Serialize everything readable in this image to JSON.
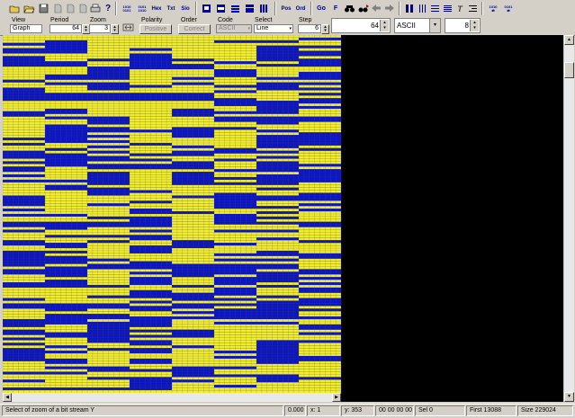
{
  "toolbar": {
    "icons": [
      "open-icon",
      "open-folder-icon",
      "save-icon",
      "document-icon",
      "document-icon",
      "document-icon",
      "print-icon",
      "help-icon",
      "bit-view-icon",
      "binary-view-icon",
      "hex-view-icon",
      "text-view-icon",
      "sio-view-icon",
      "view-mode-1-icon",
      "view-mode-2-icon",
      "view-mode-3-icon",
      "view-mode-4-icon",
      "view-mode-5-icon",
      "pos-icon",
      "ord-icon",
      "go-icon",
      "find-icon",
      "binoculars-icon",
      "find-next-icon",
      "back-icon",
      "forward-icon",
      "columns-icon",
      "align-left-icon",
      "align-justify-icon",
      "clear-format-icon",
      "align-right-icon",
      "swap-lr-icon",
      "swap-rl-icon"
    ],
    "labels": {
      "hex": "Hex",
      "txt": "Txt",
      "sio": "Sio",
      "pos": "Pos",
      "ord": "Ord",
      "go": "Go",
      "find": "F",
      "bit_top": "1010",
      "bit_bot": "0101",
      "bin_top": "0101",
      "bin_bot": "1010"
    }
  },
  "controls": {
    "view": {
      "label": "View",
      "value": "Graph"
    },
    "period": {
      "label": "Period",
      "value": "64"
    },
    "zoom": {
      "label": "Zoom",
      "value": "3"
    },
    "polarity": {
      "label": "Polarity",
      "value": "Positive"
    },
    "order": {
      "label": "Order",
      "value": "Correct"
    },
    "code": {
      "label": "Code",
      "value": "ASCII"
    },
    "select": {
      "label": "Select",
      "value": "Line"
    },
    "step": {
      "label": "Step",
      "value": "6"
    },
    "width_value": "64",
    "encoding": "ASCII",
    "columns_value": "8"
  },
  "colors": {
    "bit_on": "#f2ee2e",
    "bit_off": "#0a14c8",
    "background": "#000000",
    "grid": "#555555"
  },
  "bitmap": {
    "columns": 8,
    "rows": [
      "11111111",
      "11111110",
      "10111001",
      "00111111",
      "10111100",
      "00101101",
      "00111100",
      "11101100",
      "01101101",
      "01000100",
      "00101010",
      "00100100",
      "11000111",
      "11011011",
      "11011010",
      "10011010",
      "10010100",
      "01111111",
      "10010100",
      "11001001",
      "01011100",
      "01111011",
      "00000110",
      "00000111",
      "00000010",
      "11111000",
      "11111001",
      "11111100",
      "10110101",
      "00110001",
      "01110111",
      "10011000",
      "11011000",
      "11011101",
      "10111111",
      "10010011",
      "10000101",
      "10110110",
      "10010100",
      "00111100",
      "10011100",
      "01101100",
      "11010101",
      "10111010",
      "01010001",
      "00100111",
      "00011101",
      "10001011",
      "00110101",
      "10000100",
      "01000101",
      "01111000",
      "11010110",
      "01010100",
      "11010000",
      "00010100",
      "11010001",
      "10111111",
      "10011101",
      "11001111",
      "11011010",
      "01110000",
      "01111000",
      "01101011",
      "01011010",
      "11111001",
      "01101110",
      "11100101",
      "00111011",
      "11001001",
      "11101011",
      "00001000",
      "00001110",
      "10111111",
      "01101001",
      "11111111",
      "10001111",
      "11101101",
      "01010110",
      "00110011",
      "10100111",
      "11101111",
      "00101101",
      "01111000",
      "00111110",
      "00011001",
      "00101111",
      "01000001",
      "10000001",
      "00110010",
      "00100000",
      "10110101",
      "11101000",
      "10101001",
      "00101010",
      "00010101",
      "11111010",
      "11101010",
      "11100011",
      "11000101",
      "01110010",
      "11101100",
      "00010000",
      "00000101",
      "10101000",
      "11110001",
      "10011001",
      "10000000",
      "00101111",
      "00001001",
      "01001110",
      "11011110",
      "01000111",
      "00010110",
      "10000111",
      "01011111",
      "11001100",
      "01101101",
      "10110101",
      "01001101",
      "00101001",
      "01111101",
      "01111000",
      "00101100",
      "10101101",
      "11111111",
      "10010011",
      "11000111",
      "00110111",
      "11110001",
      "11001100",
      "01100101",
      "11101111",
      "11101011",
      "00001111",
      "11111111"
    ]
  },
  "status": {
    "hint": "Select of zoom of a bit stream Y",
    "value": "0.000",
    "x": "x: 1",
    "y": "y: 353",
    "bytes": "00 00 00 00",
    "sel": "Sel 0",
    "first": "First 13088",
    "size": "Size 229024"
  }
}
